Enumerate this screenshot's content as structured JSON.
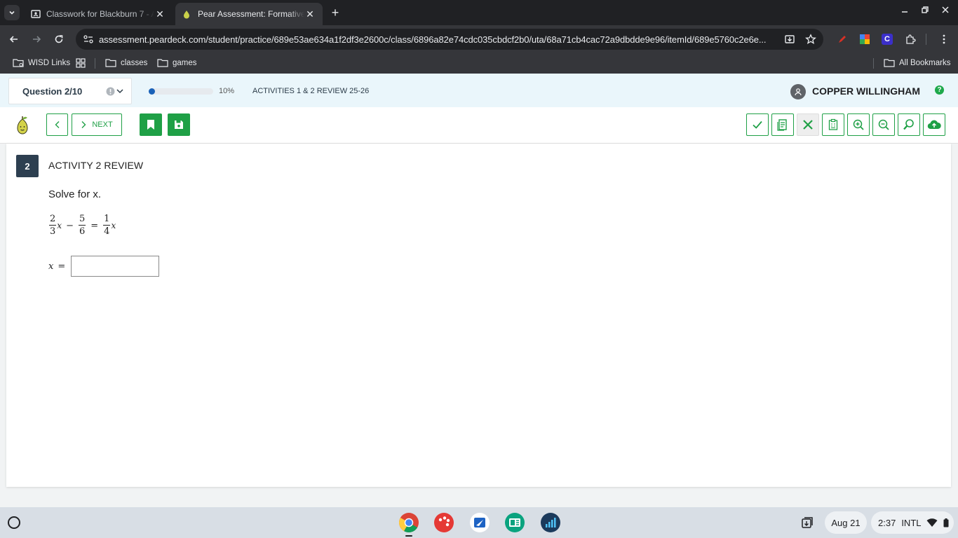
{
  "browser": {
    "tabs": [
      {
        "title": "Classwork for Blackburn 7 - Alg",
        "active": false
      },
      {
        "title": "Pear Assessment: Formative a",
        "active": true
      }
    ],
    "url": "assessment.peardeck.com/student/practice/689e53ae634a1f2df3e2600c/class/6896a82e74cdc035cbdcf2b0/uta/68a71cb4cac72a9dbdde9e96/itemId/689e5760c2e6e...",
    "bookmarks": [
      "WISD Links",
      "classes",
      "games"
    ],
    "all_bookmarks": "All Bookmarks"
  },
  "header": {
    "question_label": "Question 2/10",
    "progress_percent": 10,
    "progress_text": "10%",
    "activity_name": "ACTIVITIES 1 & 2 REVIEW 25-26",
    "user_name": "COPPER WILLINGHAM",
    "help": "?"
  },
  "toolbar": {
    "next_label": "NEXT"
  },
  "question": {
    "number": "2",
    "title": "ACTIVITY 2 REVIEW",
    "prompt": "Solve for x.",
    "equation": {
      "term1_num": "2",
      "term1_den": "3",
      "var": "x",
      "minus": "−",
      "term2_num": "5",
      "term2_den": "6",
      "equals": "=",
      "term3_num": "1",
      "term3_den": "4"
    },
    "answer_label_var": "x",
    "answer_label_eq": "=",
    "answer_value": ""
  },
  "shelf": {
    "date": "Aug 21",
    "time": "2:37",
    "locale": "INTL"
  },
  "colors": {
    "accent_green": "#1fa046",
    "progress_blue": "#1a62b8",
    "question_badge": "#2d3f50"
  }
}
